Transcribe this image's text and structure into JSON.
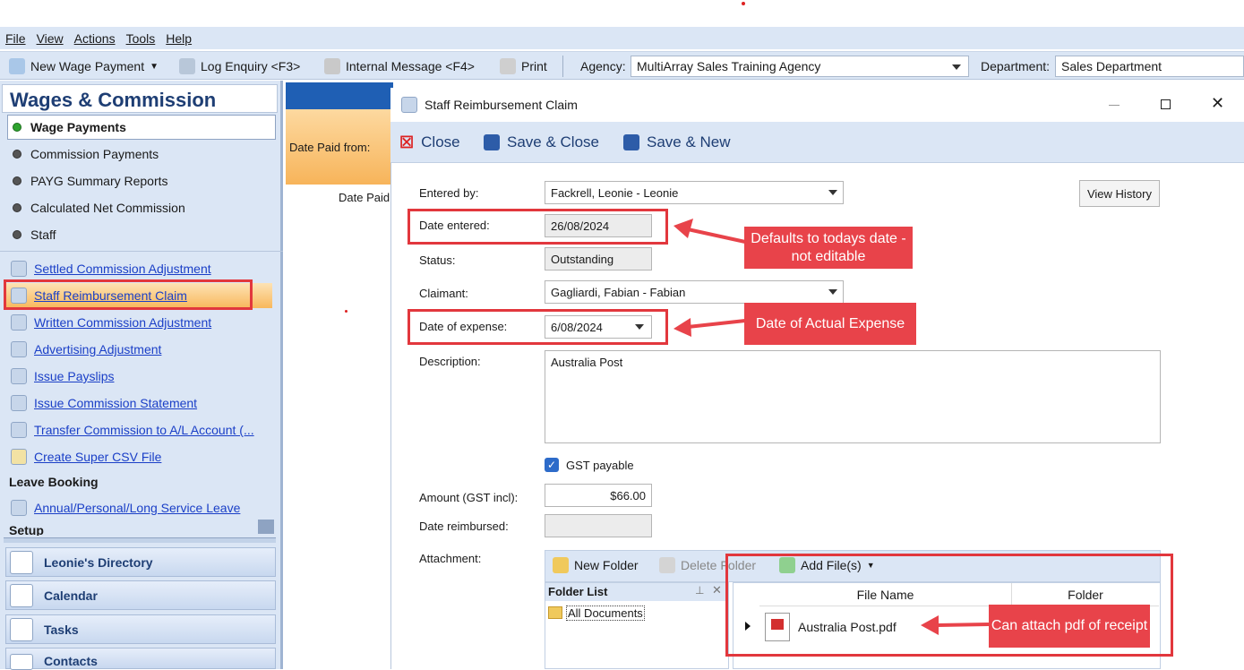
{
  "menu": [
    "File",
    "View",
    "Actions",
    "Tools",
    "Help"
  ],
  "toolbar": {
    "new_wage_payment": "New Wage Payment",
    "log_enquiry": "Log Enquiry <F3>",
    "internal_message": "Internal Message <F4>",
    "print": "Print",
    "agency_label": "Agency:",
    "agency_value": "MultiArray Sales Training Agency",
    "department_label": "Department:",
    "department_value": "Sales Department"
  },
  "sidebar": {
    "title": "Wages & Commission",
    "radios": [
      "Wage Payments",
      "Commission Payments",
      "PAYG Summary Reports",
      "Calculated Net Commission",
      "Staff"
    ],
    "links": [
      "Settled Commission Adjustment",
      "Staff Reimbursement Claim",
      "Written Commission Adjustment",
      "Advertising Adjustment",
      "Issue Payslips",
      "Issue Commission Statement",
      "Transfer Commission to A/L Account (...",
      "Create Super CSV File"
    ],
    "leave_section": "Leave Booking",
    "leave_link": "Annual/Personal/Long Service Leave",
    "setup_section": "Setup",
    "nav": [
      "Leonie's Directory",
      "Calendar",
      "Tasks",
      "Contacts"
    ]
  },
  "middle": {
    "date_paid_from": "Date Paid from:",
    "date_paid_col": "Date Paid"
  },
  "dialog": {
    "title": "Staff Reimbursement Claim",
    "close": "Close",
    "save_close": "Save & Close",
    "save_new": "Save & New",
    "view_history": "View History",
    "fields": {
      "entered_by_label": "Entered by:",
      "entered_by_value": "Fackrell, Leonie - Leonie",
      "date_entered_label": "Date entered:",
      "date_entered_value": "26/08/2024",
      "status_label": "Status:",
      "status_value": "Outstanding",
      "claimant_label": "Claimant:",
      "claimant_value": "Gagliardi, Fabian - Fabian",
      "date_expense_label": "Date of expense:",
      "date_expense_value": "6/08/2024",
      "description_label": "Description:",
      "description_value": "Australia Post",
      "gst_label": "GST payable",
      "amount_label": "Amount (GST incl):",
      "amount_value": "$66.00",
      "date_reimbursed_label": "Date reimbursed:",
      "attachment_label": "Attachment:"
    },
    "attach": {
      "new_folder": "New Folder",
      "delete_folder": "Delete Folder",
      "add_files": "Add File(s)",
      "folder_list": "Folder List",
      "all_documents": "All Documents",
      "col_file_name": "File Name",
      "col_folder": "Folder",
      "file": "Australia Post.pdf"
    }
  },
  "callouts": {
    "date_entered": "Defaults to todays date - not editable",
    "date_expense": "Date of Actual Expense",
    "attach": "Can attach pdf of receipt"
  },
  "colors": {
    "accent": "#1f5fb4",
    "callout": "#e8434a",
    "panel": "#dbe6f5"
  }
}
